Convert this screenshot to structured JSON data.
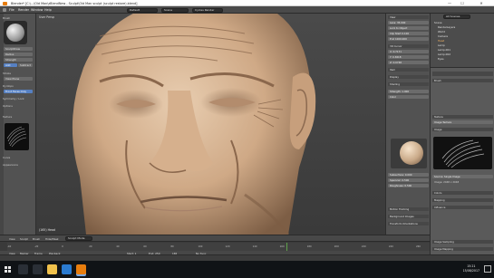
{
  "window": {
    "title": "Blender* [C:\\...\\Old Man\\zBlendNew - Sculpt\\Old Man sculpt (sculpt restore).blend]",
    "minimize": "—",
    "maximize": "☐",
    "close": "✕"
  },
  "header": {
    "menus": [
      "File",
      "Render",
      "Window",
      "Help"
    ],
    "layout": "Default",
    "scene": "Scene",
    "engine": "Cycles Render"
  },
  "toolshelf": {
    "labels": [
      "Brush",
      "Stroke",
      "Texture",
      "Curve",
      "Dyntopo",
      "Symmetry / Lock",
      "Options",
      "Appearance"
    ],
    "buttons": [
      "SculptDraw",
      "Radius",
      "Strength",
      "Add",
      "Subtract",
      "View Plane",
      "Front Faces Only"
    ]
  },
  "viewport": {
    "label": "User Persp",
    "object_label": "(165) Head"
  },
  "npanel": {
    "sections": [
      "View",
      "3D Cursor",
      "Item",
      "Display",
      "Shading",
      "Motion Tracking",
      "Background Images",
      "Transform Orientations"
    ],
    "fields": [
      "Lens: 35.000",
      "Lock to Object",
      "Clip Start 0.100",
      "End 1000.000",
      "X: 0.7171",
      "Y: 0.3618",
      "Z: 0.0748",
      "Strength: 1.000",
      "Color",
      "Subsurface: 0.000",
      "Specular: 0.500",
      "Roughness: 0.500"
    ]
  },
  "outliner": {
    "header": "All Scenes",
    "items": [
      "Scene",
      "RenderLayers",
      "World",
      "Camera",
      "Head",
      "Lamp",
      "Lamp.001",
      "Lamp.002",
      "Eyes"
    ]
  },
  "properties": {
    "rows": [
      "Brush",
      "Texture",
      "Image",
      "Image Texture",
      "Source: Single Image",
      "Image: 2048 x 2048",
      "Colors",
      "Mapping",
      "Influence",
      "Image Sampling",
      "Image Mapping"
    ]
  },
  "view_header": {
    "items": [
      "View",
      "Sculpt",
      "Brush",
      "Hide/Mask",
      "Sculpt Mode"
    ]
  },
  "timeline": {
    "ticks": [
      "-40",
      "-20",
      "0",
      "20",
      "40",
      "60",
      "80",
      "100",
      "120",
      "140",
      "160",
      "180",
      "200",
      "220",
      "240",
      "260"
    ],
    "current_frame": 165,
    "header": [
      "View",
      "Marker",
      "Frame",
      "Playback",
      "Start: 1",
      "End: 250",
      "165",
      "No Sync"
    ]
  },
  "taskbar": {
    "time": "15:21",
    "date": "15/08/2017"
  },
  "colors": {
    "accent_orange": "#e87d0d",
    "selection_blue": "#5680c2",
    "timeline_cursor": "#5fa14b"
  }
}
